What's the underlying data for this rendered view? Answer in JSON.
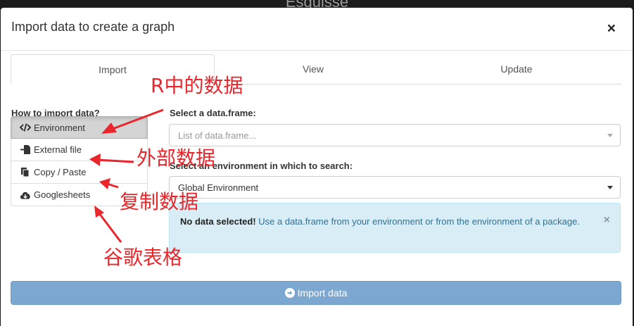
{
  "background_title": "Esquisse",
  "modal": {
    "title": "Import data to create a graph",
    "close_glyph": "×"
  },
  "tabs": [
    {
      "label": "Import",
      "active": true
    },
    {
      "label": "View",
      "active": false
    },
    {
      "label": "Update",
      "active": false
    }
  ],
  "left": {
    "heading": "How to import data?",
    "items": [
      {
        "label": "Environment",
        "icon": "code-icon",
        "active": true
      },
      {
        "label": "External file",
        "icon": "file-import-icon",
        "active": false
      },
      {
        "label": "Copy / Paste",
        "icon": "copy-icon",
        "active": false
      },
      {
        "label": "Googlesheets",
        "icon": "cloud-download-icon",
        "active": false
      }
    ]
  },
  "right": {
    "dataframe_label": "Select a data.frame:",
    "dataframe_placeholder": "List of data.frame...",
    "env_label": "Select an environment in which to search:",
    "env_value": "Global Environment",
    "alert_bold": "No data selected!",
    "alert_text": " Use a data.frame from your environment or from the environment of a package.",
    "alert_close": "×"
  },
  "import_button": {
    "label": "Import data",
    "icon": "arrow-circle-right-icon"
  },
  "annotations": {
    "r_data": "R中的数据",
    "external": "外部数据",
    "copy": "复制数据",
    "google": "谷歌表格"
  },
  "colors": {
    "annotation": "#e8262b",
    "primary_button": "#7ba7d1",
    "alert_bg": "#d9edf7"
  }
}
